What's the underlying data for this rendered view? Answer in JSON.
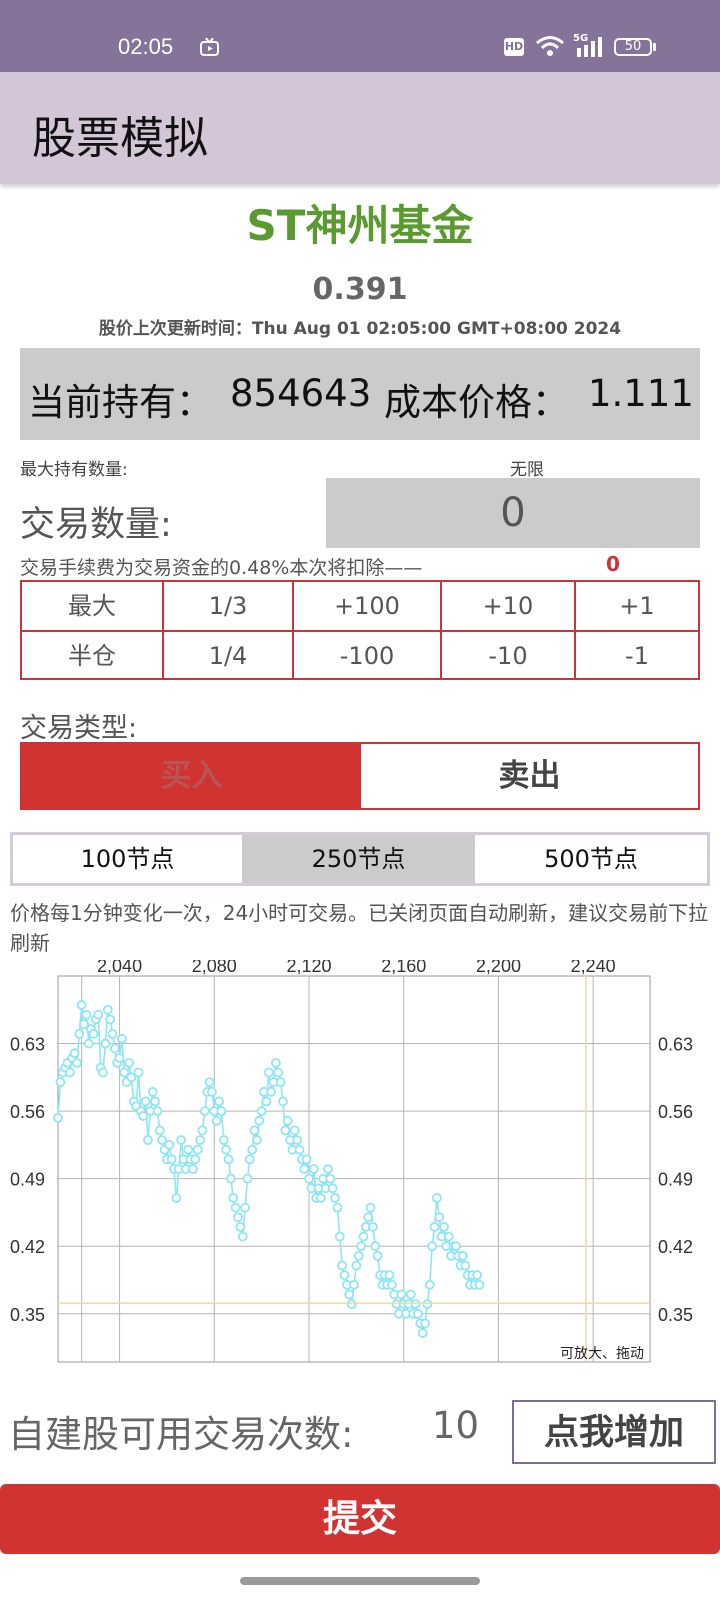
{
  "status_bar": {
    "time": "02:05",
    "battery": "50",
    "network": "5G",
    "hd": "HD"
  },
  "app_title": "股票模拟",
  "stock": {
    "name": "ST神州基金",
    "price": "0.391",
    "updated_text": "股价上次更新时间：Thu Aug 01 02:05:00 GMT+08:00 2024"
  },
  "holding": {
    "label": "当前持有：",
    "value": "854643",
    "cost_label": "成本价格：",
    "cost_value": "1.111"
  },
  "max_hold": {
    "label": "最大持有数量:",
    "value": "无限"
  },
  "quantity": {
    "label": "交易数量:",
    "value": "0"
  },
  "fee": {
    "text": "交易手续费为交易资金的0.48%本次将扣除——",
    "value": "0"
  },
  "qty_buttons": [
    [
      "最大",
      "1/3",
      "+100",
      "+10",
      "+1"
    ],
    [
      "半仓",
      "1/4",
      "-100",
      "-10",
      "-1"
    ]
  ],
  "trade_type": {
    "label": "交易类型:",
    "buy": "买入",
    "sell": "卖出"
  },
  "node_tabs": [
    "100节点",
    "250节点",
    "500节点"
  ],
  "notice": "价格每1分钟变化一次，24小时可交易。已关闭页面自动刷新，建议交易前下拉刷新",
  "chart_data": {
    "type": "line",
    "x_ticks": [
      "2,040",
      "2,080",
      "2,120",
      "2,160",
      "2,200",
      "2,240"
    ],
    "y_ticks": [
      "0.63",
      "0.56",
      "0.49",
      "0.42",
      "0.35"
    ],
    "xlim": [
      2014,
      2264
    ],
    "ylim": [
      0.3,
      0.7
    ],
    "hint": "可放大、拖动",
    "crosshair": {
      "x": 2237,
      "y": 0.361
    },
    "series": [
      {
        "color": "#8ee6f2",
        "x_start": 2014,
        "x_step": 1,
        "values": [
          0.553,
          0.59,
          0.6,
          0.605,
          0.61,
          0.6,
          0.615,
          0.62,
          0.61,
          0.64,
          0.67,
          0.65,
          0.66,
          0.63,
          0.645,
          0.64,
          0.655,
          0.66,
          0.605,
          0.6,
          0.63,
          0.665,
          0.655,
          0.64,
          0.625,
          0.61,
          0.615,
          0.635,
          0.6,
          0.59,
          0.61,
          0.595,
          0.57,
          0.565,
          0.6,
          0.56,
          0.555,
          0.57,
          0.53,
          0.56,
          0.58,
          0.57,
          0.56,
          0.54,
          0.53,
          0.52,
          0.51,
          0.525,
          0.51,
          0.5,
          0.47,
          0.5,
          0.53,
          0.51,
          0.5,
          0.52,
          0.51,
          0.5,
          0.51,
          0.52,
          0.53,
          0.54,
          0.56,
          0.58,
          0.59,
          0.58,
          0.56,
          0.55,
          0.57,
          0.56,
          0.53,
          0.52,
          0.51,
          0.49,
          0.47,
          0.46,
          0.45,
          0.44,
          0.43,
          0.46,
          0.49,
          0.51,
          0.52,
          0.54,
          0.53,
          0.55,
          0.56,
          0.58,
          0.57,
          0.6,
          0.58,
          0.59,
          0.61,
          0.6,
          0.59,
          0.57,
          0.54,
          0.55,
          0.53,
          0.52,
          0.54,
          0.53,
          0.52,
          0.51,
          0.5,
          0.51,
          0.49,
          0.48,
          0.5,
          0.47,
          0.48,
          0.47,
          0.49,
          0.48,
          0.5,
          0.49,
          0.48,
          0.47,
          0.46,
          0.43,
          0.4,
          0.39,
          0.38,
          0.37,
          0.36,
          0.38,
          0.4,
          0.41,
          0.42,
          0.43,
          0.44,
          0.45,
          0.46,
          0.44,
          0.42,
          0.41,
          0.39,
          0.38,
          0.39,
          0.38,
          0.39,
          0.38,
          0.37,
          0.36,
          0.35,
          0.37,
          0.36,
          0.35,
          0.36,
          0.37,
          0.35,
          0.36,
          0.35,
          0.34,
          0.33,
          0.34,
          0.36,
          0.38,
          0.42,
          0.44,
          0.47,
          0.45,
          0.43,
          0.44,
          0.42,
          0.43,
          0.41,
          0.42,
          0.42,
          0.41,
          0.4,
          0.41,
          0.4,
          0.39,
          0.38,
          0.39,
          0.38,
          0.39,
          0.38
        ]
      }
    ]
  },
  "self_built": {
    "label": "自建股可用交易次数:",
    "count": "10",
    "add_button": "点我增加"
  },
  "submit": "提交"
}
